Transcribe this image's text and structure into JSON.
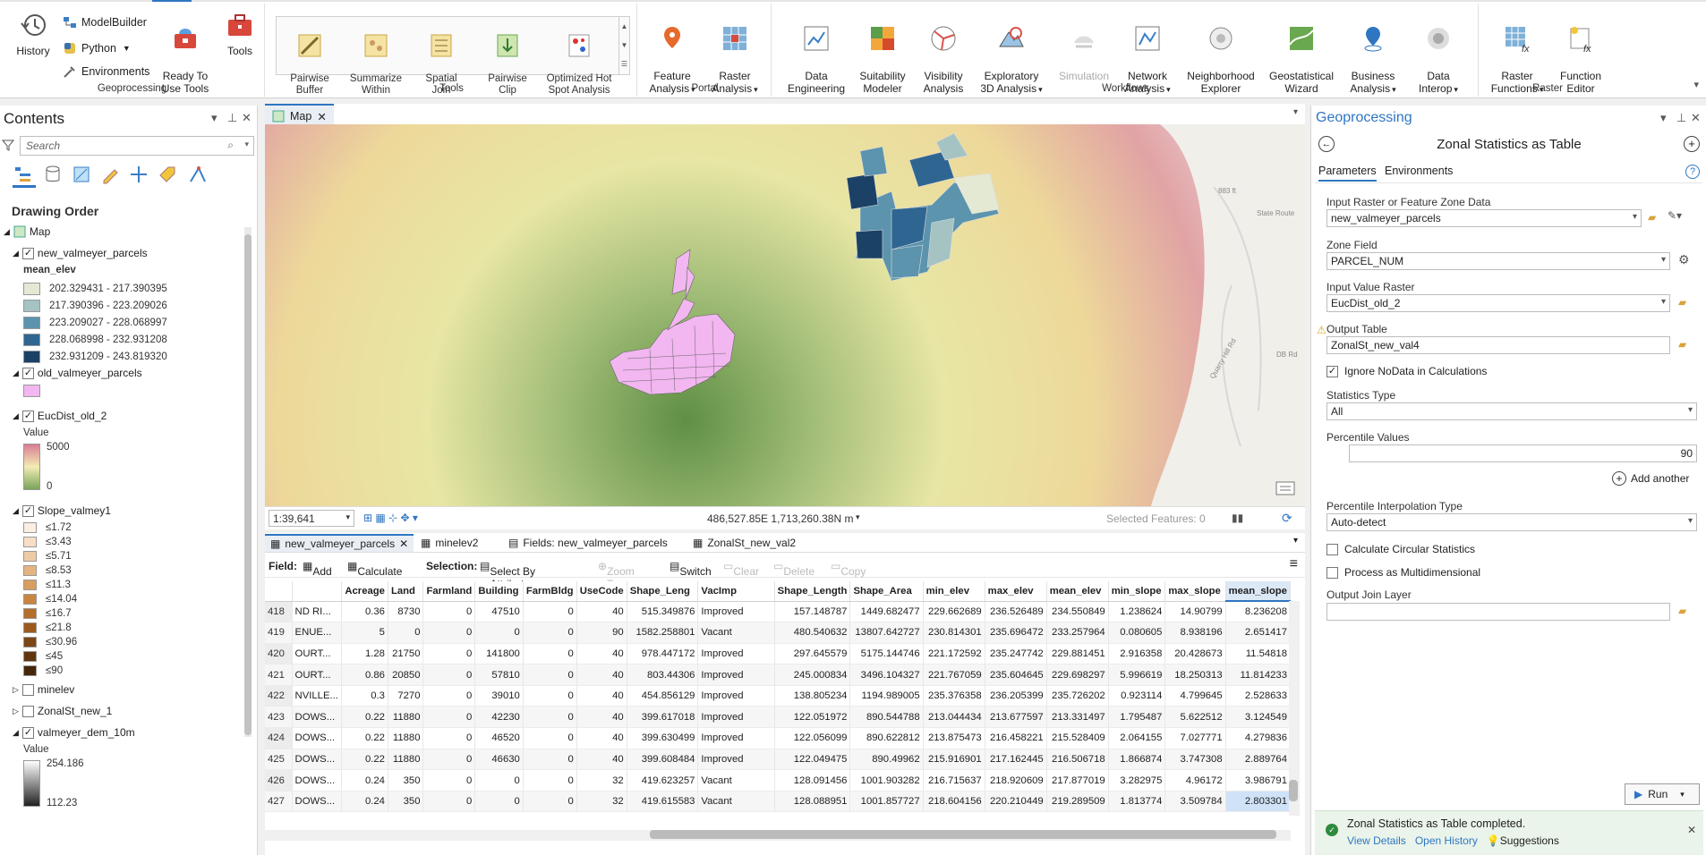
{
  "ribbon": {
    "geoprocessing": {
      "label": "Geoprocessing",
      "history": "History",
      "modelbuilder": "ModelBuilder",
      "python": "Python",
      "environments": "Environments",
      "ready_to_use": "Ready To\nUse Tools",
      "tools": "Tools"
    },
    "tools_group": {
      "label": "Tools",
      "items": [
        "Pairwise\nBuffer",
        "Summarize\nWithin",
        "Spatial\nJoin",
        "Pairwise\nClip",
        "Optimized Hot\nSpot Analysis"
      ]
    },
    "portal": {
      "label": "Portal",
      "items": [
        "Feature\nAnalysis",
        "Raster\nAnalysis"
      ]
    },
    "workflows": {
      "label": "Workflows",
      "items": [
        "Data\nEngineering",
        "Suitability\nModeler",
        "Visibility\nAnalysis",
        "Exploratory\n3D Analysis",
        "Simulation",
        "Network\nAnalysis",
        "Neighborhood\nExplorer",
        "Geostatistical\nWizard",
        "Business\nAnalysis",
        "Data\nInterop"
      ]
    },
    "raster": {
      "label": "Raster",
      "items": [
        "Raster\nFunctions",
        "Function\nEditor"
      ]
    }
  },
  "contents": {
    "title": "Contents",
    "search_placeholder": "Search",
    "drawing_order": "Drawing Order",
    "map_label": "Map",
    "layers": {
      "new_valmeyer_parcels": {
        "name": "new_valmeyer_parcels",
        "field": "mean_elev",
        "classes": [
          {
            "label": "202.329431 - 217.390395",
            "color": "#e4e9d3"
          },
          {
            "label": "217.390396 - 223.209026",
            "color": "#a5c3c2"
          },
          {
            "label": "223.209027 - 228.068997",
            "color": "#5c93ad"
          },
          {
            "label": "228.068998 - 232.931208",
            "color": "#2f6691"
          },
          {
            "label": "232.931209 - 243.819320",
            "color": "#1b4266"
          }
        ]
      },
      "old_valmeyer_parcels": {
        "name": "old_valmeyer_parcels",
        "color": "#f2b6f0"
      },
      "eucdist": {
        "name": "EucDist_old_2",
        "value_label": "Value",
        "max": "5000",
        "min": "0"
      },
      "slope": {
        "name": "Slope_valmey1",
        "classes": [
          {
            "label": "≤1.72",
            "color": "#fbeee3"
          },
          {
            "label": "≤3.43",
            "color": "#f7dfc6"
          },
          {
            "label": "≤5.71",
            "color": "#efcba5"
          },
          {
            "label": "≤8.53",
            "color": "#e6b481"
          },
          {
            "label": "≤11.3",
            "color": "#d99d5e"
          },
          {
            "label": "≤14.04",
            "color": "#c98541"
          },
          {
            "label": "≤16.7",
            "color": "#b56e2c"
          },
          {
            "label": "≤21.8",
            "color": "#9c5a1f"
          },
          {
            "label": "≤30.96",
            "color": "#7d4616"
          },
          {
            "label": "≤45",
            "color": "#60350f"
          },
          {
            "label": "≤90",
            "color": "#45260a"
          }
        ]
      },
      "minelev": {
        "name": "minelev"
      },
      "zonalst": {
        "name": "ZonalSt_new_1"
      },
      "dem": {
        "name": "valmeyer_dem_10m",
        "value_label": "Value",
        "max": "254.186",
        "min": "112.23"
      }
    }
  },
  "map": {
    "tab": "Map",
    "scale": "1:39,641",
    "coords": "486,527.85E 1,713,260.38N m",
    "selected": "Selected Features: 0",
    "labels": [
      "883 ft",
      "State Route",
      "Quarry Hill Rd",
      "DB Rd"
    ]
  },
  "table": {
    "tabs": [
      "new_valmeyer_parcels",
      "minelev2",
      "Fields: new_valmeyer_parcels",
      "ZonalSt_new_val2"
    ],
    "toolbar": {
      "field": "Field:",
      "add": "Add",
      "calculate": "Calculate",
      "selection": "Selection:",
      "select_by_attributes": "Select By Attributes",
      "zoom_to": "Zoom To",
      "switch": "Switch",
      "clear": "Clear",
      "delete": "Delete",
      "copy": "Copy"
    },
    "columns": [
      "",
      "",
      "Acreage",
      "Land",
      "Farmland",
      "Building",
      "FarmBldg",
      "UseCode",
      "Shape_Leng",
      "VacImp",
      "Shape_Length",
      "Shape_Area",
      "min_elev",
      "max_elev",
      "mean_elev",
      "min_slope",
      "max_slope",
      "mean_slope"
    ],
    "rows": [
      [
        "418",
        "ND RI...",
        "0.36",
        "8730",
        "0",
        "47510",
        "0",
        "40",
        "515.349876",
        "Improved",
        "157.148787",
        "1449.682477",
        "229.662689",
        "236.526489",
        "234.550849",
        "1.238624",
        "14.90799",
        "8.236208"
      ],
      [
        "419",
        "ENUE...",
        "5",
        "0",
        "0",
        "0",
        "0",
        "90",
        "1582.258801",
        "Vacant",
        "480.540632",
        "13807.642727",
        "230.814301",
        "235.696472",
        "233.257964",
        "0.080605",
        "8.938196",
        "2.651417"
      ],
      [
        "420",
        "OURT...",
        "1.28",
        "21750",
        "0",
        "141800",
        "0",
        "40",
        "978.447172",
        "Improved",
        "297.645579",
        "5175.144746",
        "221.172592",
        "235.247742",
        "229.881451",
        "2.916358",
        "20.428673",
        "11.54818"
      ],
      [
        "421",
        "OURT...",
        "0.86",
        "20850",
        "0",
        "57810",
        "0",
        "40",
        "803.44306",
        "Improved",
        "245.000834",
        "3496.104327",
        "221.767059",
        "235.604645",
        "229.698297",
        "5.996619",
        "18.250313",
        "11.814233"
      ],
      [
        "422",
        "NVILLE...",
        "0.3",
        "7270",
        "0",
        "39010",
        "0",
        "40",
        "454.856129",
        "Improved",
        "138.805234",
        "1194.989005",
        "235.376358",
        "236.205399",
        "235.726202",
        "0.923114",
        "4.799645",
        "2.528633"
      ],
      [
        "423",
        "DOWS...",
        "0.22",
        "11880",
        "0",
        "42230",
        "0",
        "40",
        "399.617018",
        "Improved",
        "122.051972",
        "890.544788",
        "213.044434",
        "213.677597",
        "213.331497",
        "1.795487",
        "5.622512",
        "3.124549"
      ],
      [
        "424",
        "DOWS...",
        "0.22",
        "11880",
        "0",
        "46520",
        "0",
        "40",
        "399.630499",
        "Improved",
        "122.056099",
        "890.622812",
        "213.875473",
        "216.458221",
        "215.528409",
        "2.064155",
        "7.027771",
        "4.279836"
      ],
      [
        "425",
        "DOWS...",
        "0.22",
        "11880",
        "0",
        "46630",
        "0",
        "40",
        "399.608484",
        "Improved",
        "122.049475",
        "890.49962",
        "215.916901",
        "217.162445",
        "216.506718",
        "1.866874",
        "3.747308",
        "2.889764"
      ],
      [
        "426",
        "DOWS...",
        "0.24",
        "350",
        "0",
        "0",
        "0",
        "32",
        "419.623257",
        "Vacant",
        "128.091456",
        "1001.903282",
        "216.715637",
        "218.920609",
        "217.877019",
        "3.282975",
        "4.96172",
        "3.986791"
      ],
      [
        "427",
        "DOWS...",
        "0.24",
        "350",
        "0",
        "0",
        "0",
        "32",
        "419.615583",
        "Vacant",
        "128.088951",
        "1001.857727",
        "218.604156",
        "220.210449",
        "219.289509",
        "1.813774",
        "3.509784",
        "2.803301"
      ]
    ]
  },
  "geoprocessing": {
    "title": "Geoprocessing",
    "tool": "Zonal Statistics as Table",
    "tabs": [
      "Parameters",
      "Environments"
    ],
    "input_label": "Input Raster or Feature Zone Data",
    "input_value": "new_valmeyer_parcels",
    "zone_label": "Zone Field",
    "zone_value": "PARCEL_NUM",
    "value_raster_label": "Input Value Raster",
    "value_raster_value": "EucDist_old_2",
    "output_label": "Output Table",
    "output_value": "ZonalSt_new_val4",
    "ignore_nodata": "Ignore NoData in Calculations",
    "stats_label": "Statistics Type",
    "stats_value": "All",
    "percentile_label": "Percentile Values",
    "percentile_value": "90",
    "add_another": "Add another",
    "interp_label": "Percentile Interpolation Type",
    "interp_value": "Auto-detect",
    "circular": "Calculate Circular Statistics",
    "multidim": "Process as Multidimensional",
    "join_label": "Output Join Layer",
    "run": "Run",
    "toast": {
      "message": "Zonal Statistics as Table completed.",
      "view_details": "View Details",
      "open_history": "Open History",
      "suggestions": "Suggestions"
    }
  }
}
